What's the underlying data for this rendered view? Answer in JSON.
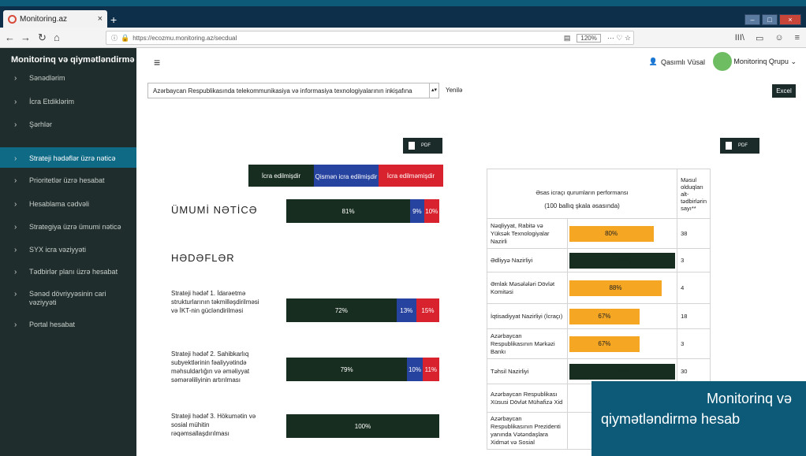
{
  "browser": {
    "tab_title": "Monitoring.az",
    "tab_close": "×",
    "new_tab": "+",
    "url": "https://ecozmu.monitoring.az/secdual",
    "zoom": "120%",
    "page_actions": "··· ♡ ☆",
    "toolbar_icons": [
      "III\\",
      "▭",
      "☺",
      "≡"
    ]
  },
  "sidebar": {
    "title": "Monitorinq və qiymətləndirmə",
    "items": [
      {
        "label": "Sənədlərim"
      },
      {
        "label": "İcra Etdiklərim"
      },
      {
        "label": "Şərhlər"
      },
      {
        "label": "Strateji hədəflər üzrə nəticə"
      },
      {
        "label": "Prioritetlər üzrə hesabat"
      },
      {
        "label": "Hesablama cədvəli"
      },
      {
        "label": "Strategiya üzrə ümumi nəticə"
      },
      {
        "label": "SYX icra vəziyyəti"
      },
      {
        "label": "Tədbirlər planı üzrə hesabat"
      },
      {
        "label": "Sənəd dövriyyəsinin cari vəziyyəti"
      },
      {
        "label": "Portal hesabat"
      }
    ]
  },
  "header": {
    "user": "Qasımlı Vüsal",
    "group": "Monitorinq Qrupu"
  },
  "controls": {
    "select_value": "Azərbaycan Respublikasında telekommunikasiya və informasiya texnologiyalarının inkişafına",
    "refresh_label": "Yenilə",
    "excel_label": "Excel",
    "pdf_label": "PDF"
  },
  "legend": {
    "done": "İcra edilmişdir",
    "partial": "Qismən icra edilmişdir",
    "not_done": "İcra edilməmişdir"
  },
  "colors": {
    "done": "#172d1f",
    "partial": "#2743a0",
    "not_done": "#d8232f",
    "perf_bar": "#f5a623"
  },
  "overall": {
    "label": "ÜMUMİ NƏTİCƏ",
    "done": 81,
    "partial": 9,
    "not_done": 10,
    "done_text": "81%",
    "partial_text": "9%",
    "not_done_text": "10%"
  },
  "goals_title": "HƏDƏFLƏR",
  "goals": [
    {
      "text": "Strateji hədəf 1. İdarəetmə strukturlarının təkmilləşdirilməsi və İKT-nin gücləndirilməsi",
      "done": 72,
      "partial": 13,
      "not_done": 15,
      "done_text": "72%",
      "partial_text": "13%",
      "not_done_text": "15%"
    },
    {
      "text": "Strateji hədəf 2. Sahibkarlıq subyektlərinin fəaliyyətində məhsuldarlığın və əməliyyat səmərəliliyinin artırılması",
      "done": 79,
      "partial": 10,
      "not_done": 11,
      "done_text": "79%",
      "partial_text": "10%",
      "not_done_text": "11%"
    },
    {
      "text": "Strateji hədəf 3. Hökumətin və sosial mühitin rəqəmsallaşdırılması",
      "done": 100,
      "partial": 0,
      "not_done": 0,
      "done_text": "100%",
      "partial_text": "",
      "not_done_text": ""
    }
  ],
  "performance": {
    "title": "Əsas icraçı qurumların performansı",
    "subtitle": "(100 ballıq şkala əsasında)",
    "count_header": "Məsul olduqları alt-tədbirlərin sayı**",
    "rows": [
      {
        "org": "Nəqliyyat, Rabitə və Yüksək Texnologiyalar Nazirli",
        "score": 80,
        "score_text": "80%",
        "count": "38",
        "color": "orange"
      },
      {
        "org": "Ədliyyə Nazirliyi",
        "score": 100,
        "score_text": "100%",
        "count": "3",
        "color": "dark"
      },
      {
        "org": "Əmlak Məsələləri Dövlət Komitəsi",
        "score": 88,
        "score_text": "88%",
        "count": "4",
        "color": "orange"
      },
      {
        "org": "İqtisadiyyat Nazirliyi (İcraçı)",
        "score": 67,
        "score_text": "67%",
        "count": "18",
        "color": "orange"
      },
      {
        "org": "Azərbaycan Respublikasının Mərkəzi Bankı",
        "score": 67,
        "score_text": "67%",
        "count": "3",
        "color": "orange"
      },
      {
        "org": "Təhsil Nazirliyi",
        "score": 100,
        "score_text": "100%",
        "count": "30",
        "color": "dark"
      },
      {
        "org": "Azərbaycan Respublikası Xüsusi Dövlət Mühafizə Xid",
        "score": null,
        "score_text": "",
        "count": "",
        "color": "none"
      },
      {
        "org": "Azərbaycan Respublikasının Prezidenti yanında Vətəndaşlara Xidmət və Sosial",
        "score": null,
        "score_text": "",
        "count": "",
        "color": "none"
      }
    ]
  },
  "watermark": {
    "line1": "Monitorinq və",
    "line2": "qiymətləndirmə hesab"
  }
}
